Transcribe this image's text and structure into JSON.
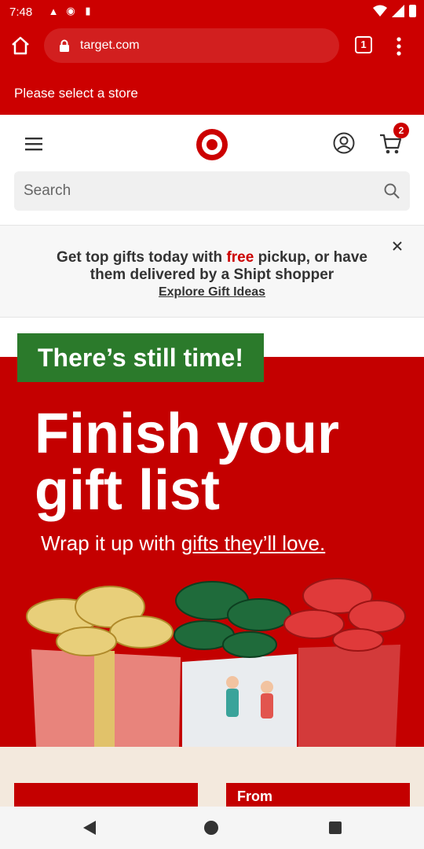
{
  "status": {
    "time": "7:48"
  },
  "browser": {
    "url": "target.com",
    "tab_count": "1"
  },
  "store_bar": {
    "text": "Please select a store"
  },
  "header": {
    "cart_count": "2",
    "search_placeholder": "Search"
  },
  "promo": {
    "line1_a": "Get top gifts today with ",
    "line1_free": "free",
    "line1_b": " pickup, or have",
    "line2": "them delivered by a Shipt shopper",
    "link": "Explore Gift Ideas"
  },
  "hero": {
    "tag": "There’s still time!",
    "title_line1": "Finish your",
    "title_line2": "gift list",
    "subtitle_a": "Wrap it up with ",
    "subtitle_link": "gifts they’ll love."
  },
  "peek": {
    "right_card_text": "From"
  },
  "colors": {
    "brand": "#cc0000",
    "green_tag": "#2b7a2b"
  }
}
